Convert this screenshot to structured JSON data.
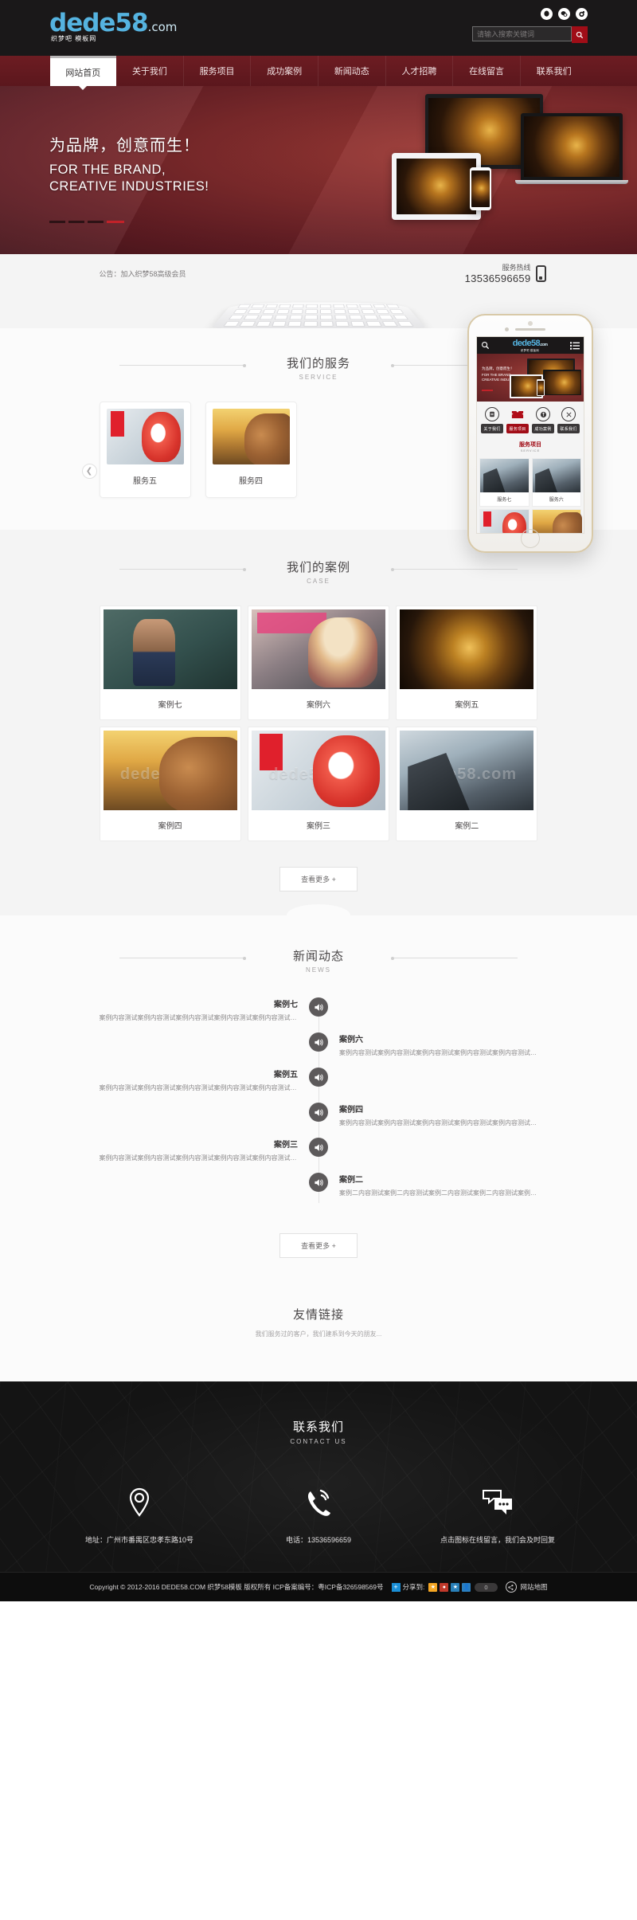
{
  "header": {
    "logo": {
      "main": "dede58",
      "suffix": ".com",
      "sub": "织梦吧  模板网"
    },
    "social": [
      "qq-icon",
      "wechat-icon",
      "weibo-icon"
    ],
    "search": {
      "placeholder": "请输入搜索关键词",
      "value": "",
      "button_icon": "search-icon"
    }
  },
  "nav": {
    "items": [
      {
        "label": "网站首页",
        "active": true
      },
      {
        "label": "关于我们",
        "active": false
      },
      {
        "label": "服务项目",
        "active": false
      },
      {
        "label": "成功案例",
        "active": false
      },
      {
        "label": "新闻动态",
        "active": false
      },
      {
        "label": "人才招聘",
        "active": false
      },
      {
        "label": "在线留言",
        "active": false
      },
      {
        "label": "联系我们",
        "active": false
      }
    ]
  },
  "hero": {
    "headline_cn": "为品牌，创意而生！",
    "headline_en_line1": "FOR THE BRAND,",
    "headline_en_line2": "CREATIVE INDUSTRIES!"
  },
  "notice": {
    "text": "公告：加入织梦58高级会员",
    "hotline_label": "服务热线",
    "hotline_number": "13536596659",
    "hotline_icon": "mobile-phone-icon"
  },
  "service": {
    "title_cn": "我们的服务",
    "title_en": "SERVICE",
    "prev_icon": "chevron-left-icon",
    "cards": [
      {
        "label": "服务五",
        "art": "art-hero6"
      },
      {
        "label": "服务四",
        "art": "art-horse"
      }
    ]
  },
  "phone_mockup": {
    "logo": {
      "main": "dede58",
      "suffix": ".com",
      "sub": "织梦吧 模板网"
    },
    "search_icon": "search-icon",
    "menu_icon": "hamburger-menu-icon",
    "banner": {
      "cn": "为品牌，创意而生！",
      "en_line1": "FOR THE BRAND,",
      "en_line2": "CREATIVE INDUSTRIES!"
    },
    "nav": [
      {
        "label": "关于我们",
        "icon": "document-icon",
        "active": false
      },
      {
        "label": "服务项目",
        "icon": "box-icon",
        "active": true
      },
      {
        "label": "成功案例",
        "icon": "medal-icon",
        "active": false
      },
      {
        "label": "联系我们",
        "icon": "scissors-icon",
        "active": false
      }
    ],
    "section": {
      "cn": "服务项目",
      "en": "SERVICE"
    },
    "cards": [
      {
        "label": "服务七",
        "art": "art-climb"
      },
      {
        "label": "服务六",
        "art": "art-climb"
      },
      {
        "label": "",
        "art": "art-hero6"
      },
      {
        "label": "",
        "art": "art-horse"
      }
    ]
  },
  "cases": {
    "title_cn": "我们的案例",
    "title_en": "CASE",
    "watermark": "dede58.com",
    "items": [
      {
        "label": "案例七",
        "art": "art-chalk"
      },
      {
        "label": "案例六",
        "art": "art-mag"
      },
      {
        "label": "案例五",
        "art": "art-gold"
      },
      {
        "label": "案例四",
        "art": "art-horse"
      },
      {
        "label": "案例三",
        "art": "art-hero6"
      },
      {
        "label": "案例二",
        "art": "art-climb"
      }
    ],
    "more_label": "查看更多 +"
  },
  "news": {
    "title_cn": "新闻动态",
    "title_en": "NEWS",
    "icon": "speaker-announce-icon",
    "items": [
      {
        "side": "left",
        "title": "案例七",
        "desc": "案例内容测试案例内容测试案例内容测试案例内容测试案例内容测试案例内容测试案..."
      },
      {
        "side": "right",
        "title": "案例六",
        "desc": "案例内容测试案例内容测试案例内容测试案例内容测试案例内容测试案例内容测试案..."
      },
      {
        "side": "left",
        "title": "案例五",
        "desc": "案例内容测试案例内容测试案例内容测试案例内容测试案例内容测试案例内容测试案..."
      },
      {
        "side": "right",
        "title": "案例四",
        "desc": "案例内容测试案例内容测试案例内容测试案例内容测试案例内容测试案例内容测试案..."
      },
      {
        "side": "left",
        "title": "案例三",
        "desc": "案例内容测试案例内容测试案例内容测试案例内容测试案例内容测试案例内容测试案..."
      },
      {
        "side": "right",
        "title": "案例二",
        "desc": "案例二内容测试案例二内容测试案例二内容测试案例二内容测试案例二内容测试案例二内容测试..."
      }
    ],
    "more_label": "查看更多 +"
  },
  "links": {
    "title_cn": "友情链接",
    "desc": "我们服务过的客户，我们建系到今天的朋友..."
  },
  "footer": {
    "title_cn": "联系我们",
    "title_en": "CONTACT US",
    "columns": [
      {
        "icon": "location-pin-icon",
        "text": "地址：广州市番禺区忠孝东路10号"
      },
      {
        "icon": "phone-call-icon",
        "text": "电话：13536596659"
      },
      {
        "icon": "chat-bubbles-icon",
        "text": "点击图标在线留言，我们会及时回复"
      }
    ],
    "copyright": "Copyright © 2012-2016 DEDE58.COM 织梦58模板 版权所有  ICP备案编号：粤ICP备326598569号",
    "share_label": "分享到:",
    "share_plus": "+",
    "share_icons": [
      "star-icon",
      "renren-icon",
      "qzone-icon",
      "people-icon"
    ],
    "share_count": "0",
    "sitemap_icon": "share-node-icon",
    "sitemap_label": "网站地图"
  },
  "colors": {
    "brand_blue": "#55b3e0",
    "accent_red": "#a00d17",
    "nav_maroon": "#5b171d",
    "dark": "#1a1819"
  }
}
